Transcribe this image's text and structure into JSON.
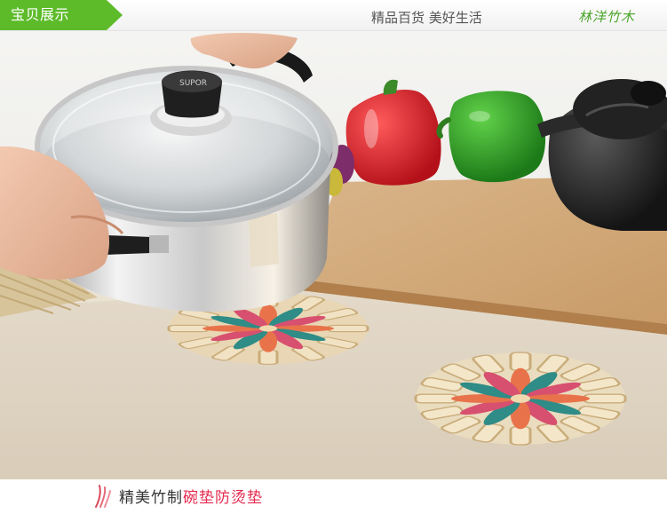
{
  "header": {
    "tab_label": "宝贝展示",
    "slogan": "精品百货 美好生活",
    "brand": "林洋竹木",
    "accent_color": "#5dbb2a"
  },
  "photo": {
    "lid_knob_text": "SUPOR"
  },
  "caption": {
    "prefix": "精美竹制",
    "highlight": "碗垫防烫垫",
    "icon": "bamboo-leaf-icon",
    "highlight_color": "#e5294d"
  }
}
